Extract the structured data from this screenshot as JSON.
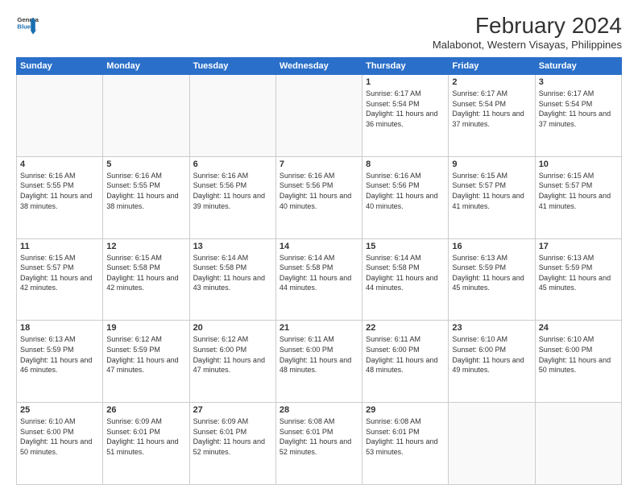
{
  "logo": {
    "line1": "General",
    "line2": "Blue"
  },
  "title": "February 2024",
  "subtitle": "Malabonot, Western Visayas, Philippines",
  "days_header": [
    "Sunday",
    "Monday",
    "Tuesday",
    "Wednesday",
    "Thursday",
    "Friday",
    "Saturday"
  ],
  "weeks": [
    [
      {
        "day": "",
        "info": ""
      },
      {
        "day": "",
        "info": ""
      },
      {
        "day": "",
        "info": ""
      },
      {
        "day": "",
        "info": ""
      },
      {
        "day": "1",
        "info": "Sunrise: 6:17 AM\nSunset: 5:54 PM\nDaylight: 11 hours\nand 36 minutes."
      },
      {
        "day": "2",
        "info": "Sunrise: 6:17 AM\nSunset: 5:54 PM\nDaylight: 11 hours\nand 37 minutes."
      },
      {
        "day": "3",
        "info": "Sunrise: 6:17 AM\nSunset: 5:54 PM\nDaylight: 11 hours\nand 37 minutes."
      }
    ],
    [
      {
        "day": "4",
        "info": "Sunrise: 6:16 AM\nSunset: 5:55 PM\nDaylight: 11 hours\nand 38 minutes."
      },
      {
        "day": "5",
        "info": "Sunrise: 6:16 AM\nSunset: 5:55 PM\nDaylight: 11 hours\nand 38 minutes."
      },
      {
        "day": "6",
        "info": "Sunrise: 6:16 AM\nSunset: 5:56 PM\nDaylight: 11 hours\nand 39 minutes."
      },
      {
        "day": "7",
        "info": "Sunrise: 6:16 AM\nSunset: 5:56 PM\nDaylight: 11 hours\nand 40 minutes."
      },
      {
        "day": "8",
        "info": "Sunrise: 6:16 AM\nSunset: 5:56 PM\nDaylight: 11 hours\nand 40 minutes."
      },
      {
        "day": "9",
        "info": "Sunrise: 6:15 AM\nSunset: 5:57 PM\nDaylight: 11 hours\nand 41 minutes."
      },
      {
        "day": "10",
        "info": "Sunrise: 6:15 AM\nSunset: 5:57 PM\nDaylight: 11 hours\nand 41 minutes."
      }
    ],
    [
      {
        "day": "11",
        "info": "Sunrise: 6:15 AM\nSunset: 5:57 PM\nDaylight: 11 hours\nand 42 minutes."
      },
      {
        "day": "12",
        "info": "Sunrise: 6:15 AM\nSunset: 5:58 PM\nDaylight: 11 hours\nand 42 minutes."
      },
      {
        "day": "13",
        "info": "Sunrise: 6:14 AM\nSunset: 5:58 PM\nDaylight: 11 hours\nand 43 minutes."
      },
      {
        "day": "14",
        "info": "Sunrise: 6:14 AM\nSunset: 5:58 PM\nDaylight: 11 hours\nand 44 minutes."
      },
      {
        "day": "15",
        "info": "Sunrise: 6:14 AM\nSunset: 5:58 PM\nDaylight: 11 hours\nand 44 minutes."
      },
      {
        "day": "16",
        "info": "Sunrise: 6:13 AM\nSunset: 5:59 PM\nDaylight: 11 hours\nand 45 minutes."
      },
      {
        "day": "17",
        "info": "Sunrise: 6:13 AM\nSunset: 5:59 PM\nDaylight: 11 hours\nand 45 minutes."
      }
    ],
    [
      {
        "day": "18",
        "info": "Sunrise: 6:13 AM\nSunset: 5:59 PM\nDaylight: 11 hours\nand 46 minutes."
      },
      {
        "day": "19",
        "info": "Sunrise: 6:12 AM\nSunset: 5:59 PM\nDaylight: 11 hours\nand 47 minutes."
      },
      {
        "day": "20",
        "info": "Sunrise: 6:12 AM\nSunset: 6:00 PM\nDaylight: 11 hours\nand 47 minutes."
      },
      {
        "day": "21",
        "info": "Sunrise: 6:11 AM\nSunset: 6:00 PM\nDaylight: 11 hours\nand 48 minutes."
      },
      {
        "day": "22",
        "info": "Sunrise: 6:11 AM\nSunset: 6:00 PM\nDaylight: 11 hours\nand 48 minutes."
      },
      {
        "day": "23",
        "info": "Sunrise: 6:10 AM\nSunset: 6:00 PM\nDaylight: 11 hours\nand 49 minutes."
      },
      {
        "day": "24",
        "info": "Sunrise: 6:10 AM\nSunset: 6:00 PM\nDaylight: 11 hours\nand 50 minutes."
      }
    ],
    [
      {
        "day": "25",
        "info": "Sunrise: 6:10 AM\nSunset: 6:00 PM\nDaylight: 11 hours\nand 50 minutes."
      },
      {
        "day": "26",
        "info": "Sunrise: 6:09 AM\nSunset: 6:01 PM\nDaylight: 11 hours\nand 51 minutes."
      },
      {
        "day": "27",
        "info": "Sunrise: 6:09 AM\nSunset: 6:01 PM\nDaylight: 11 hours\nand 52 minutes."
      },
      {
        "day": "28",
        "info": "Sunrise: 6:08 AM\nSunset: 6:01 PM\nDaylight: 11 hours\nand 52 minutes."
      },
      {
        "day": "29",
        "info": "Sunrise: 6:08 AM\nSunset: 6:01 PM\nDaylight: 11 hours\nand 53 minutes."
      },
      {
        "day": "",
        "info": ""
      },
      {
        "day": "",
        "info": ""
      }
    ]
  ]
}
